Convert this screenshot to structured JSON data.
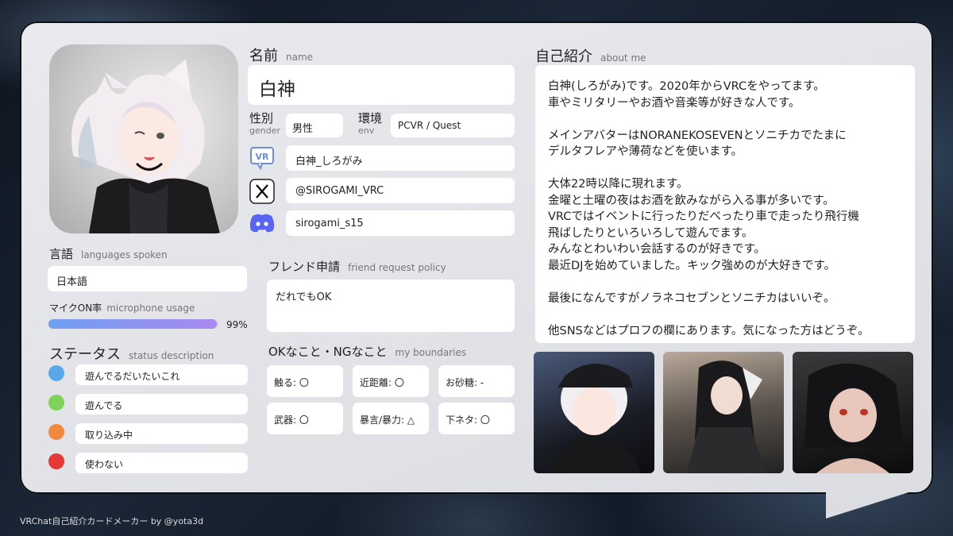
{
  "name": {
    "label": "名前",
    "label_en": "name",
    "value": "白神"
  },
  "gender": {
    "label": "性別",
    "label_en": "gender",
    "value": "男性"
  },
  "env": {
    "label": "環境",
    "label_en": "env",
    "value": "PCVR / Quest"
  },
  "accounts": {
    "vrchat": {
      "icon": "vrchat-icon",
      "value": "白神_しろがみ"
    },
    "x": {
      "icon": "x-icon",
      "value": "@SIROGAMI_VRC"
    },
    "discord": {
      "icon": "discord-icon",
      "value": "sirogami_s15"
    }
  },
  "languages": {
    "label": "言語",
    "label_en": "languages spoken",
    "value": "日本語"
  },
  "mic": {
    "label": "マイクON率",
    "label_en": "microphone usage",
    "percent_text": "99%",
    "percent": 99
  },
  "status": {
    "label": "ステータス",
    "label_en": "status description",
    "items": [
      {
        "color": "#5aa8e8",
        "text": "遊んでるだいたいこれ"
      },
      {
        "color": "#7ed35a",
        "text": "遊んでる"
      },
      {
        "color": "#f0883e",
        "text": "取り込み中"
      },
      {
        "color": "#e53935",
        "text": "使わない"
      }
    ]
  },
  "friend": {
    "label": "フレンド申請",
    "label_en": "friend request policy",
    "value": "だれでもOK"
  },
  "boundaries": {
    "label": "OKなこと・NGなこと",
    "label_en": "my boundaries",
    "items": [
      "触る: 〇",
      "近距離: 〇",
      "お砂糖: -",
      "武器: 〇",
      "暴言/暴力: △",
      "下ネタ: 〇"
    ]
  },
  "about": {
    "label": "自己紹介",
    "label_en": "about me",
    "lines": [
      "白神(しろがみ)です。2020年からVRCをやってます。",
      "車やミリタリーやお酒や音楽等が好きな人です。",
      "",
      "メインアバターはNORANEKOSEVENとソニチカでたまに",
      "デルタフレアや薄荷などを使います。",
      "",
      "大体22時以降に現れます。",
      "金曜と土曜の夜はお酒を飲みながら入る事が多いです。",
      "VRCではイベントに行ったりだべったり車で走ったり飛行機",
      "飛ばしたりといろいろして遊んでます。",
      "みんなとわいわい会話するのが好きです。",
      "最近DJを始めていました。キック強めのが大好きです。",
      "",
      "最後になんですがノラネコセブンとソニチカはいいぞ。",
      "",
      "他SNSなどはプロフの欄にあります。気になった方はどうぞ。"
    ]
  },
  "footer": "VRChat自己紹介カードメーカー by @yota3d"
}
